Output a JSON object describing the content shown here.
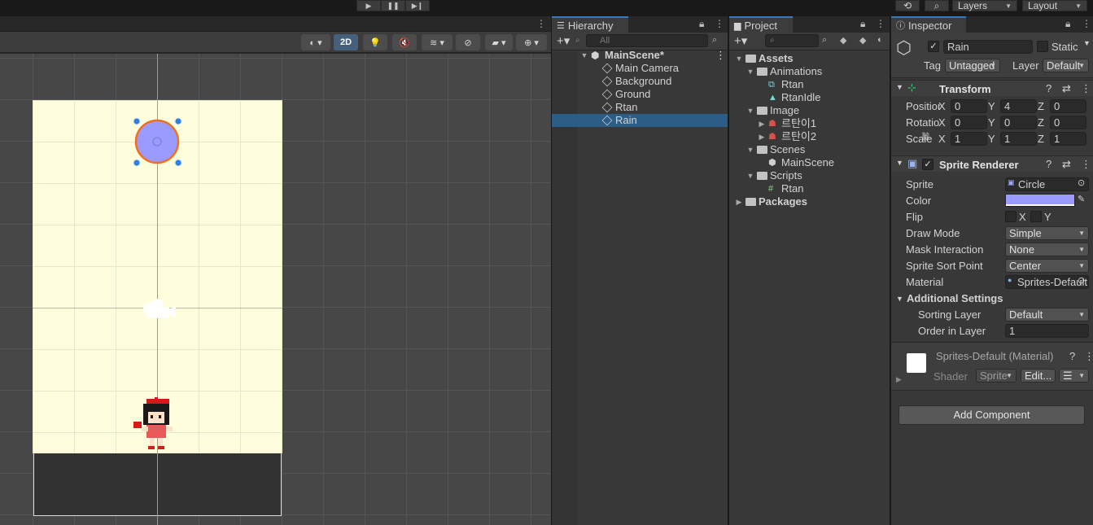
{
  "toolbar": {
    "history_icon": "history-icon",
    "search_icon": "search-icon",
    "layers_label": "Layers",
    "layout_label": "Layout"
  },
  "scene": {
    "mode_2d_label": "2D",
    "gizmo_icons": [
      "shading-mode-icon",
      "lighting-icon",
      "audio-icon",
      "effects-icon",
      "visibility-icon",
      "camera-icon",
      "gizmos-icon"
    ]
  },
  "hierarchy": {
    "tab_label": "Hierarchy",
    "search_placeholder": "All",
    "scene_name": "MainScene*",
    "items": [
      {
        "label": "Main Camera",
        "selected": false
      },
      {
        "label": "Background",
        "selected": false
      },
      {
        "label": "Ground",
        "selected": false
      },
      {
        "label": "Rtan",
        "selected": false
      },
      {
        "label": "Rain",
        "selected": true
      }
    ]
  },
  "project": {
    "tab_label": "Project",
    "tree": [
      {
        "label": "Assets",
        "depth": 0,
        "type": "folder",
        "bold": true
      },
      {
        "label": "Animations",
        "depth": 1,
        "type": "folder"
      },
      {
        "label": "Rtan",
        "depth": 2,
        "type": "animator"
      },
      {
        "label": "RtanIdle",
        "depth": 2,
        "type": "anim"
      },
      {
        "label": "Image",
        "depth": 1,
        "type": "folder"
      },
      {
        "label": "르탄이1",
        "depth": 2,
        "type": "sprite",
        "expandable": true
      },
      {
        "label": "르탄이2",
        "depth": 2,
        "type": "sprite",
        "expandable": true
      },
      {
        "label": "Scenes",
        "depth": 1,
        "type": "folder"
      },
      {
        "label": "MainScene",
        "depth": 2,
        "type": "scene"
      },
      {
        "label": "Scripts",
        "depth": 1,
        "type": "folder"
      },
      {
        "label": "Rtan",
        "depth": 2,
        "type": "script"
      },
      {
        "label": "Packages",
        "depth": 0,
        "type": "folder",
        "bold": true,
        "collapsed": true
      }
    ]
  },
  "inspector": {
    "tab_label": "Inspector",
    "object_name": "Rain",
    "static_label": "Static",
    "tag_label": "Tag",
    "tag_value": "Untagged",
    "layer_label": "Layer",
    "layer_value": "Default",
    "transform": {
      "title": "Transform",
      "position_label": "Position",
      "rotation_label": "Rotation",
      "scale_label": "Scale",
      "position": {
        "x": "0",
        "y": "4",
        "z": "0"
      },
      "rotation": {
        "x": "0",
        "y": "0",
        "z": "0"
      },
      "scale": {
        "x": "1",
        "y": "1",
        "z": "1"
      }
    },
    "sprite_renderer": {
      "title": "Sprite Renderer",
      "sprite_label": "Sprite",
      "sprite_value": "Circle",
      "color_label": "Color",
      "color_value": "#9a9aff",
      "flip_label": "Flip",
      "flip_x": "X",
      "flip_y": "Y",
      "draw_mode_label": "Draw Mode",
      "draw_mode_value": "Simple",
      "mask_label": "Mask Interaction",
      "mask_value": "None",
      "sort_point_label": "Sprite Sort Point",
      "sort_point_value": "Center",
      "material_label": "Material",
      "material_value": "Sprites-Default",
      "additional_label": "Additional Settings",
      "sorting_layer_label": "Sorting Layer",
      "sorting_layer_value": "Default",
      "order_label": "Order in Layer",
      "order_value": "1"
    },
    "material": {
      "title": "Sprites-Default (Material)",
      "shader_label": "Shader",
      "shader_value": "Sprite",
      "edit_label": "Edit..."
    },
    "add_component_label": "Add Component"
  },
  "colors": {
    "accent": "#3a79bb",
    "selection": "#2c5d87",
    "rain_fill": "#9a9aff",
    "rain_outline": "#f07020",
    "background_sprite": "#fefedc"
  }
}
